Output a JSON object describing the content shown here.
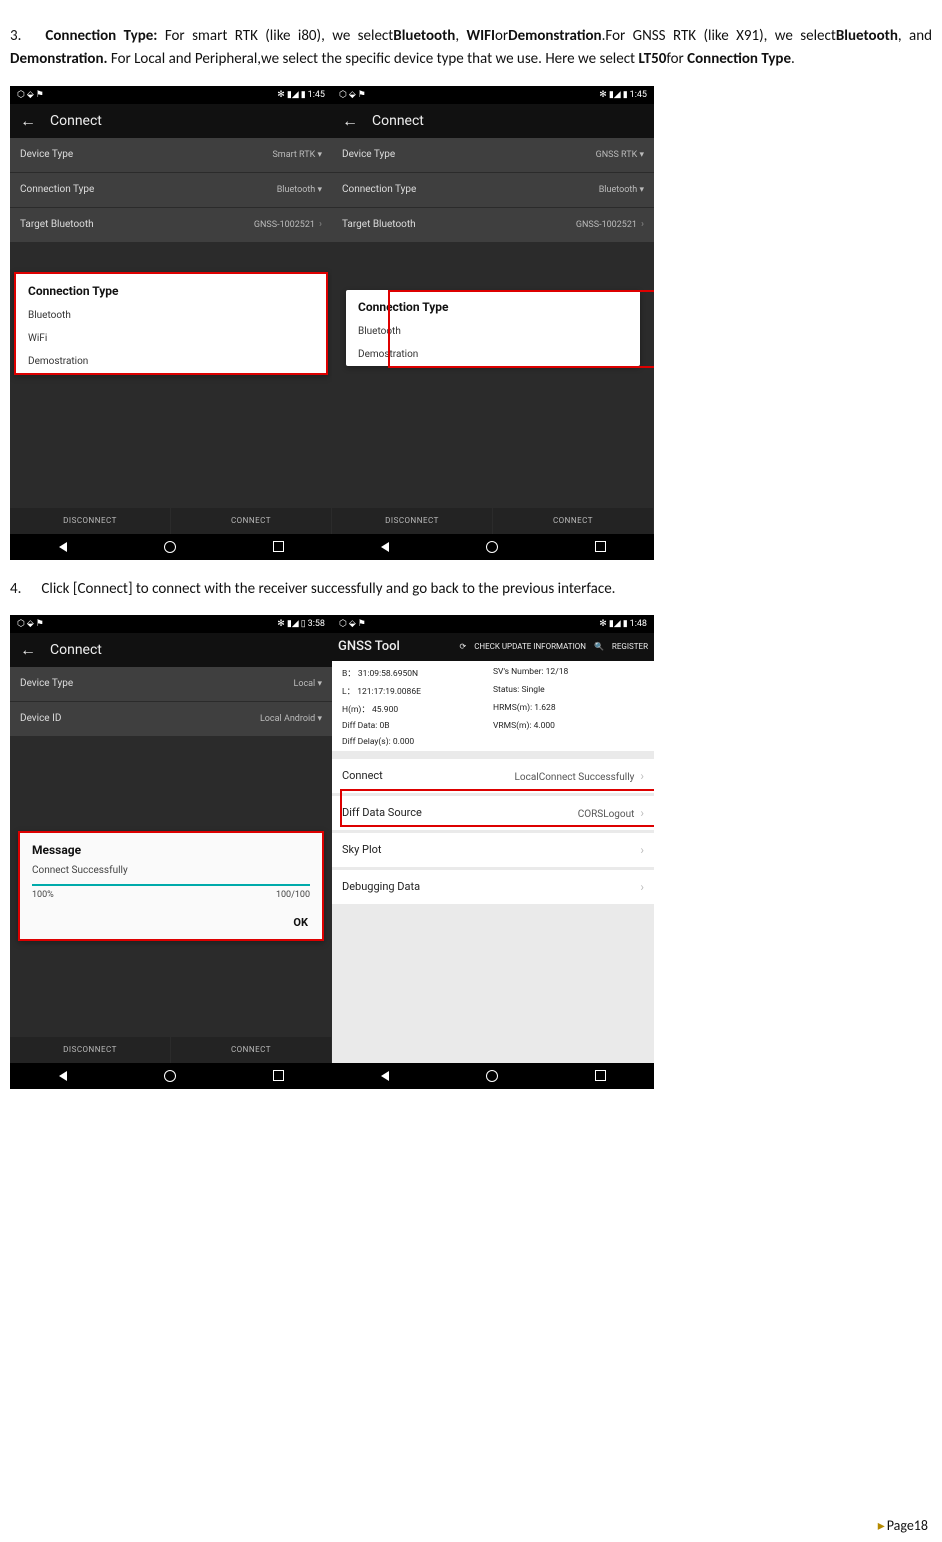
{
  "step3": {
    "num": "3.",
    "label": "Connection Type:",
    "t1": " For smart RTK (like i80), we select",
    "b1": "Bluetooth",
    "t2": ", ",
    "b2": "WIFI",
    "t3": "or",
    "b3": "Demonstration",
    "t4": ".For GNSS RTK (like X91), we select",
    "b4": "Bluetooth",
    "t5": ", and ",
    "b5": "Demonstration.",
    "t6": " For Local and Peripheral,we select the specific device type that we use. Here we select ",
    "b6": "LT50",
    "t7": "for ",
    "b7": "Connection Type",
    "t8": "."
  },
  "step4": {
    "num": "4.",
    "text": "Click [Connect] to connect with the receiver successfully and go back to the previous interface."
  },
  "common": {
    "time1": "1:45",
    "time358": "3:58",
    "time148": "1:48",
    "bt": "✻",
    "net": "▮◢",
    "connect_title": "Connect",
    "gnss_tool": "GNSS Tool",
    "check_update": "CHECK UPDATE INFORMATION",
    "register": "REGISTER",
    "device_type": "Device Type",
    "connection_type": "Connection Type",
    "target_bt": "Target Bluetooth",
    "device_id": "Device ID",
    "disconnect": "DISCONNECT",
    "connect": "CONNECT",
    "chev": "›"
  },
  "s1": {
    "device_type_val": "Smart RTK  ▾",
    "conn_type_val": "Bluetooth  ▾",
    "target_val": "GNSS-1002521",
    "popup_title": "Connection Type",
    "o1": "Bluetooth",
    "o2": "WiFi",
    "o3": "Demostration"
  },
  "s2": {
    "device_type_val": "GNSS RTK  ▾",
    "conn_type_val": "Bluetooth  ▾",
    "target_val": "GNSS-1002521",
    "popup_title": "Connection Type",
    "o1": "Bluetooth",
    "o2": "Demostration"
  },
  "s3": {
    "device_type_val": "Local  ▾",
    "device_id_val": "Local Android  ▾",
    "msg_title": "Message",
    "msg_body": "Connect Successfully",
    "p1": "100%",
    "p2": "100/100",
    "ok": "OK"
  },
  "s4": {
    "b_lbl": "B：",
    "b_val": "31:09:58.6950N",
    "l_lbl": "L：",
    "l_val": "121:17:19.0086E",
    "h_lbl": "H(m)：",
    "h_val": "45.900",
    "dd_lbl": "Diff Data:",
    "dd_val": "0B",
    "dly_lbl": "Diff Delay(s):",
    "dly_val": "0.000",
    "sv_lbl": "SV's Number:",
    "sv_val": "12/18",
    "st_lbl": "Status:",
    "st_val": "Single",
    "hr_lbl": "HRMS(m):",
    "hr_val": "1.628",
    "vr_lbl": "VRMS(m):",
    "vr_val": "4.000",
    "r1l": "Connect",
    "r1v": "LocalConnect Successfully",
    "r2l": "Diff Data Source",
    "r2v": "CORSLogout",
    "r3l": "Sky Plot",
    "r4l": "Debugging Data"
  },
  "footer": {
    "mark": "▸",
    "text": "Page18"
  }
}
